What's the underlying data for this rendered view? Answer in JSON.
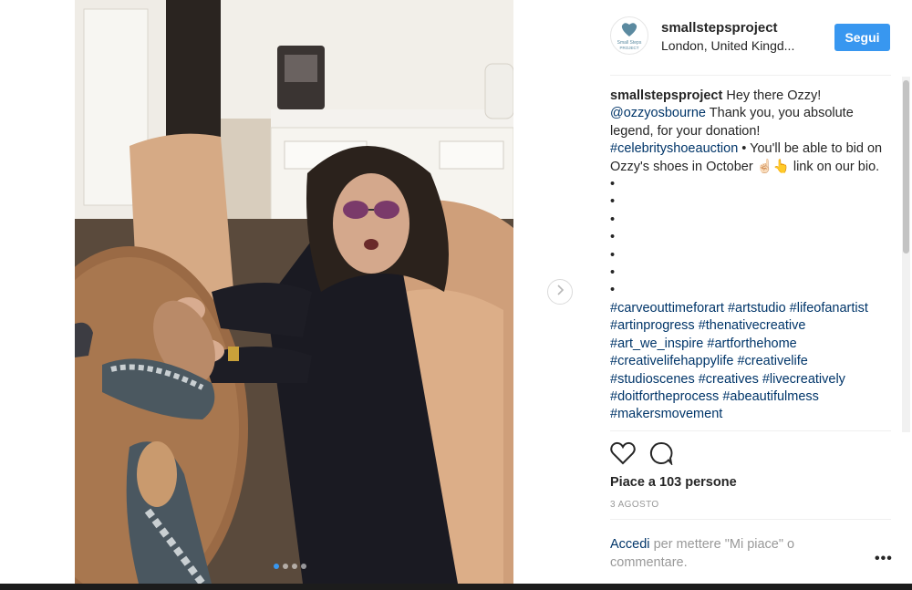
{
  "post": {
    "username": "smallstepsproject",
    "location": "London, United Kingd...",
    "follow_label": "Segui",
    "avatar_text_line1": "Small Steps",
    "avatar_text_line2": "PROJECT",
    "caption": {
      "username": "smallstepsproject",
      "text1": "Hey there Ozzy!",
      "mention": "@ozzyosbourne",
      "text2": "Thank you, you absolute legend, for your donation!",
      "hashtag1": "#celebrityshoeauction",
      "text3": "• You'll be able to bid on Ozzy's shoes in October ☝🏻👆 link on our bio.",
      "bullets": [
        "•",
        "•",
        "•",
        "•",
        "•",
        "•",
        "•"
      ],
      "hashtags": [
        "#carveouttimeforart",
        "#artstudio",
        "#lifeofanartist",
        "#artinprogress",
        "#thenativecreative",
        "#art_we_inspire",
        "#artforthehome",
        "#creativelifehappylife",
        "#creativelife",
        "#studioscenes",
        "#creatives",
        "#livecreatively",
        "#doitfortheprocess",
        "#abeautifulmess",
        "#makersmovement"
      ]
    },
    "likes": "Piace a 103 persone",
    "date": "3 AGOSTO",
    "login_link": "Accedi",
    "login_text": "per mettere \"Mi piace\" o commentare.",
    "more_label": "•••"
  },
  "carousel": {
    "slide_count": 4,
    "active_index": 0
  },
  "icons": {
    "like": "heart-icon",
    "comment": "comment-icon",
    "next": "chevron-right-icon",
    "tag": "user-tag-icon"
  },
  "colors": {
    "accent": "#3897f0",
    "link": "#003569",
    "muted": "#999999"
  }
}
